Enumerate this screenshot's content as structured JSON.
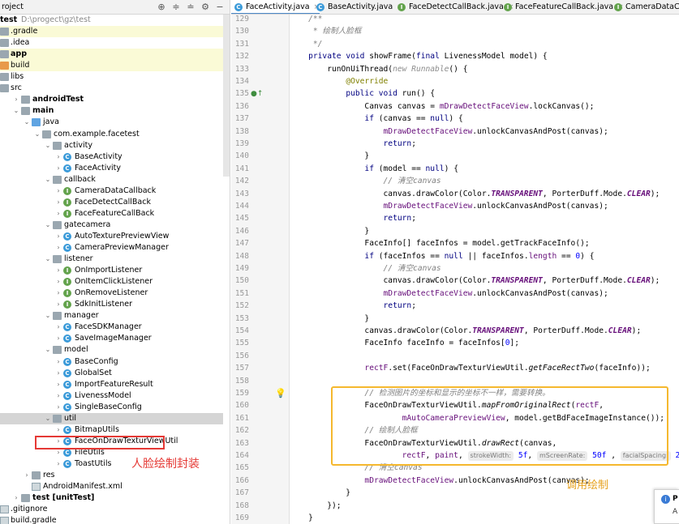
{
  "project": {
    "title": "roject",
    "tree": [
      {
        "label": "test",
        "suffix": "D:\\progect\\gz\\test",
        "depth": 0,
        "arrow": "",
        "icon": "none",
        "bold": true
      },
      {
        "label": ".gradle",
        "depth": 0,
        "arrow": "",
        "icon": "folder",
        "hl": true
      },
      {
        "label": ".idea",
        "depth": 0,
        "arrow": "",
        "icon": "folder"
      },
      {
        "label": "app",
        "depth": 0,
        "arrow": "",
        "icon": "folder",
        "bold": true,
        "hl": true
      },
      {
        "label": "build",
        "depth": 0,
        "arrow": "",
        "icon": "folder-orange",
        "hl": true
      },
      {
        "label": "libs",
        "depth": 0,
        "arrow": "",
        "icon": "folder"
      },
      {
        "label": "src",
        "depth": 0,
        "arrow": "",
        "icon": "folder"
      },
      {
        "label": "androidTest",
        "depth": 1,
        "arrow": ">",
        "icon": "folder",
        "bold": true
      },
      {
        "label": "main",
        "depth": 1,
        "arrow": "v",
        "icon": "folder",
        "bold": true
      },
      {
        "label": "java",
        "depth": 2,
        "arrow": "v",
        "icon": "folder-blue"
      },
      {
        "label": "com.example.facetest",
        "depth": 3,
        "arrow": "v",
        "icon": "pkg"
      },
      {
        "label": "activity",
        "depth": 4,
        "arrow": "v",
        "icon": "pkg"
      },
      {
        "label": "BaseActivity",
        "depth": 5,
        "arrow": ">",
        "icon": "class"
      },
      {
        "label": "FaceActivity",
        "depth": 5,
        "arrow": ">",
        "icon": "class"
      },
      {
        "label": "callback",
        "depth": 4,
        "arrow": "v",
        "icon": "pkg"
      },
      {
        "label": "CameraDataCallback",
        "depth": 5,
        "arrow": ">",
        "icon": "interface"
      },
      {
        "label": "FaceDetectCallBack",
        "depth": 5,
        "arrow": ">",
        "icon": "interface"
      },
      {
        "label": "FaceFeatureCallBack",
        "depth": 5,
        "arrow": ">",
        "icon": "interface"
      },
      {
        "label": "gatecamera",
        "depth": 4,
        "arrow": "v",
        "icon": "pkg"
      },
      {
        "label": "AutoTexturePreviewView",
        "depth": 5,
        "arrow": ">",
        "icon": "class"
      },
      {
        "label": "CameraPreviewManager",
        "depth": 5,
        "arrow": ">",
        "icon": "class"
      },
      {
        "label": "listener",
        "depth": 4,
        "arrow": "v",
        "icon": "pkg"
      },
      {
        "label": "OnImportListener",
        "depth": 5,
        "arrow": ">",
        "icon": "interface"
      },
      {
        "label": "OnItemClickListener",
        "depth": 5,
        "arrow": ">",
        "icon": "interface"
      },
      {
        "label": "OnRemoveListener",
        "depth": 5,
        "arrow": ">",
        "icon": "interface"
      },
      {
        "label": "SdkInitListener",
        "depth": 5,
        "arrow": ">",
        "icon": "interface"
      },
      {
        "label": "manager",
        "depth": 4,
        "arrow": "v",
        "icon": "pkg"
      },
      {
        "label": "FaceSDKManager",
        "depth": 5,
        "arrow": ">",
        "icon": "class"
      },
      {
        "label": "SaveImageManager",
        "depth": 5,
        "arrow": ">",
        "icon": "class"
      },
      {
        "label": "model",
        "depth": 4,
        "arrow": "v",
        "icon": "pkg"
      },
      {
        "label": "BaseConfig",
        "depth": 5,
        "arrow": ">",
        "icon": "class"
      },
      {
        "label": "GlobalSet",
        "depth": 5,
        "arrow": ">",
        "icon": "class"
      },
      {
        "label": "ImportFeatureResult",
        "depth": 5,
        "arrow": ">",
        "icon": "class"
      },
      {
        "label": "LivenessModel",
        "depth": 5,
        "arrow": ">",
        "icon": "class"
      },
      {
        "label": "SingleBaseConfig",
        "depth": 5,
        "arrow": ">",
        "icon": "class"
      },
      {
        "label": "util",
        "depth": 4,
        "arrow": "v",
        "icon": "pkg",
        "sel": true
      },
      {
        "label": "BitmapUtils",
        "depth": 5,
        "arrow": ">",
        "icon": "class"
      },
      {
        "label": "FaceOnDrawTexturViewUtil",
        "depth": 5,
        "arrow": ">",
        "icon": "class"
      },
      {
        "label": "FileUtils",
        "depth": 5,
        "arrow": ">",
        "icon": "class"
      },
      {
        "label": "ToastUtils",
        "depth": 5,
        "arrow": ">",
        "icon": "class"
      },
      {
        "label": "res",
        "depth": 2,
        "arrow": ">",
        "icon": "folder"
      },
      {
        "label": "AndroidManifest.xml",
        "depth": 2,
        "arrow": "",
        "icon": "file"
      },
      {
        "label": "test [unitTest]",
        "depth": 1,
        "arrow": ">",
        "icon": "folder",
        "bold": true
      },
      {
        "label": ".gitignore",
        "depth": 0,
        "arrow": "",
        "icon": "file"
      },
      {
        "label": "build.gradle",
        "depth": 0,
        "arrow": "",
        "icon": "file"
      }
    ],
    "annotation": "人脸绘制封装"
  },
  "tabs": [
    {
      "label": "FaceActivity.java",
      "icon": "C",
      "color": "#3a9ad9",
      "active": true
    },
    {
      "label": "BaseActivity.java",
      "icon": "C",
      "color": "#3a9ad9"
    },
    {
      "label": "FaceDetectCallBack.java",
      "icon": "I",
      "color": "#63a34c"
    },
    {
      "label": "FaceFeatureCallBack.java",
      "icon": "I",
      "color": "#63a34c"
    },
    {
      "label": "CameraDataCal",
      "icon": "I",
      "color": "#63a34c"
    }
  ],
  "editor": {
    "line_numbers": [
      "129",
      "130",
      "131",
      "132",
      "133",
      "134",
      "135",
      "136",
      "137",
      "138",
      "139",
      "140",
      "141",
      "142",
      "143",
      "144",
      "145",
      "146",
      "147",
      "148",
      "149",
      "150",
      "151",
      "152",
      "153",
      "154",
      "155",
      "156",
      "157",
      "158",
      "159",
      "160",
      "161",
      "162",
      "163",
      "164",
      "165",
      "166",
      "167",
      "168",
      "169"
    ],
    "annotation": "调用绘制"
  },
  "notification": {
    "title": "P",
    "text": "A"
  }
}
